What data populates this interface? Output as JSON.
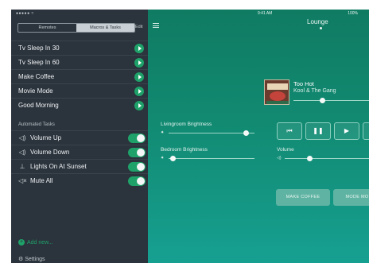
{
  "status": {
    "signal": "●●●●● ≈",
    "time": "9:41 AM",
    "battery": "100%"
  },
  "sidebar": {
    "tabs": [
      "Remotes",
      "Macros & Tasks"
    ],
    "edit_label": "Edit",
    "macros": [
      {
        "label": "Tv Sleep In 30"
      },
      {
        "label": "Tv Sleep In 60"
      },
      {
        "label": "Make Coffee"
      },
      {
        "label": "Movie Mode"
      },
      {
        "label": "Good Morning"
      }
    ],
    "automated_header": "Automated Tasks",
    "tasks": [
      {
        "label": "Volume Up",
        "icon": "speaker-icon",
        "glyph": "◁)",
        "on": true
      },
      {
        "label": "Volume Down",
        "icon": "speaker-icon",
        "glyph": "◁)",
        "on": true
      },
      {
        "label": "Lights On At Sunset",
        "icon": "sunset-icon",
        "glyph": "⊥",
        "on": true
      },
      {
        "label": "Mute All",
        "icon": "speaker-mute-icon",
        "glyph": "◁×",
        "on": true
      }
    ],
    "add_label": "Add new...",
    "settings_label": "Settings"
  },
  "main": {
    "room": "Lounge",
    "now_playing": {
      "title": "Too Hot",
      "artist": "Kool & The Gang",
      "progress": 0.38
    },
    "livingroom_brightness": {
      "label": "Livingroom Brightness",
      "value": 0.9
    },
    "bedroom_brightness": {
      "label": "Bedroom Brightness",
      "value": 0.05
    },
    "volume": {
      "label": "Volume",
      "value": 0.3
    },
    "transport_glyphs": [
      "⏮",
      "❚❚",
      "▶"
    ],
    "macro_buttons": [
      "MAKE COFFEE",
      "MODE MO"
    ]
  },
  "colors": {
    "accent": "#1fa26a",
    "sidebar_bg": "#2b333c",
    "main_top": "#0f7b62",
    "main_bottom": "#16a091"
  }
}
